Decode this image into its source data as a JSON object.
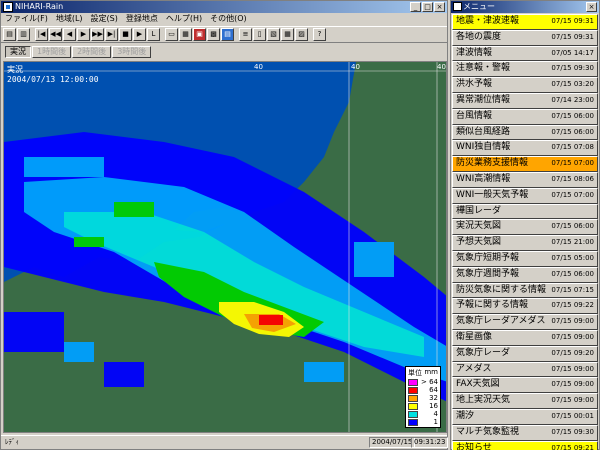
{
  "main_window": {
    "title": "NIHARI-Rain",
    "menu": [
      "ファイル(F)",
      "地域(L)",
      "設定(S)",
      "登録地点",
      "ヘルプ(H)",
      "その他(O)"
    ],
    "tabs": [
      {
        "label": "実況",
        "state": "active"
      },
      {
        "label": "1時間後",
        "state": "dim"
      },
      {
        "label": "2時間後",
        "state": "dim"
      },
      {
        "label": "3時間後",
        "state": "dim"
      }
    ],
    "overlay_mode": "実況",
    "overlay_time": "2004/07/13 12:00:00",
    "grid_labels": [
      "40",
      "40",
      "40"
    ],
    "legend": {
      "title": "単位",
      "unit": "mm",
      "levels": [
        {
          "label": "> 64",
          "color": "#ff00ff"
        },
        {
          "label": "64",
          "color": "#ff0000"
        },
        {
          "label": "32",
          "color": "#ffa500"
        },
        {
          "label": "16",
          "color": "#ffff00"
        },
        {
          "label": "4",
          "color": "#00e0e0"
        },
        {
          "label": "1",
          "color": "#0000ff"
        }
      ]
    },
    "status": {
      "left": "ﾚﾃﾞｨ",
      "date": "2004/07/15",
      "time": "09:31:23"
    }
  },
  "menu_panel": {
    "title": "メニュー",
    "items": [
      {
        "label": "地震・津波速報",
        "time": "07/15 09:31",
        "highlight": "yellow"
      },
      {
        "label": "各地の震度",
        "time": "07/15 09:31"
      },
      {
        "label": "津波情報",
        "time": "07/05 14:17"
      },
      {
        "label": "注意報・警報",
        "time": "07/15 09:30"
      },
      {
        "label": "洪水予報",
        "time": "07/15 03:20"
      },
      {
        "label": "異常潮位情報",
        "time": "07/14 23:00"
      },
      {
        "label": "台風情報",
        "time": "07/15 06:00"
      },
      {
        "label": "類似台風経路",
        "time": "07/15 06:00"
      },
      {
        "label": "WNI独自情報",
        "time": "07/15 07:08"
      },
      {
        "label": "防災業務支援情報",
        "time": "07/15 07:00",
        "highlight": "orange"
      },
      {
        "label": "WNI高潮情報",
        "time": "07/15 08:06"
      },
      {
        "label": "WNI一般天気予報",
        "time": "07/15 07:00"
      },
      {
        "label": "樺国レーダ",
        "time": ""
      },
      {
        "label": "実況天気図",
        "time": "07/15 06:00"
      },
      {
        "label": "予想天気図",
        "time": "07/15 21:00"
      },
      {
        "label": "気象庁短期予報",
        "time": "07/15 05:00"
      },
      {
        "label": "気象庁週間予報",
        "time": "07/15 06:00"
      },
      {
        "label": "防災気象に関する情報",
        "time": "07/15 07:15"
      },
      {
        "label": "予報に関する情報",
        "time": "07/15 09:22"
      },
      {
        "label": "気象庁レーダアメダス",
        "time": "07/15 09:00"
      },
      {
        "label": "衛星画像",
        "time": "07/15 09:00"
      },
      {
        "label": "気象庁レーダ",
        "time": "07/15 09:20"
      },
      {
        "label": "アメダス",
        "time": "07/15 09:00"
      },
      {
        "label": "FAX天気図",
        "time": "07/15 09:00"
      },
      {
        "label": "地上実況天気",
        "time": "07/15 09:00"
      },
      {
        "label": "潮汐",
        "time": "07/15 00:01"
      },
      {
        "label": "マルチ気象監視",
        "time": "07/15 09:30"
      },
      {
        "label": "お知らせ",
        "time": "07/15 09:21",
        "highlight": "yellow"
      }
    ]
  },
  "colors": {
    "sea": "#0050b0",
    "land": "#3a6c46",
    "highlight_yellow": "#ffff00",
    "highlight_orange": "#ffa500"
  }
}
